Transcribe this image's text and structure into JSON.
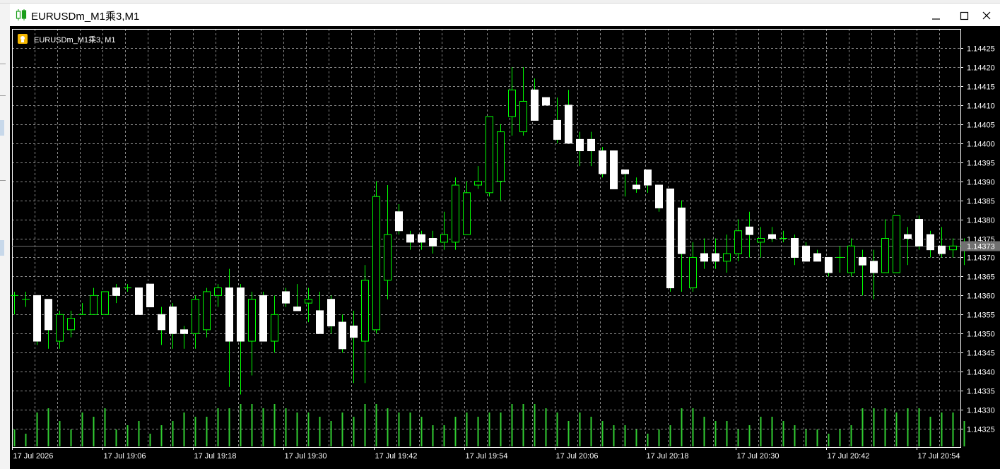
{
  "window": {
    "title": "EURUSDm_M1乘3,M1",
    "minimize_icon": "minimize-icon",
    "maximize_icon": "maximize-icon",
    "close_icon": "close-icon"
  },
  "chart_header": {
    "symbol_label": "EURUSDm_M1乘3, M1",
    "icon": "expert-advisor-icon"
  },
  "colors": {
    "background": "#000000",
    "grid": "#8a8a8a",
    "axis_text": "#ffffff",
    "bull_body": "#000000",
    "bear_body": "#ffffff",
    "candle_outline": "#00ff00",
    "volume": "#32cd32",
    "price_line": "#707070",
    "price_tag": "#707070"
  },
  "chart_data": {
    "type": "candlestick",
    "symbol": "EURUSDm_M1乘3",
    "timeframe": "M1",
    "y_ticks": [
      "1.14425",
      "1.14420",
      "1.14415",
      "1.14410",
      "1.14405",
      "1.14400",
      "1.14395",
      "1.14390",
      "1.14385",
      "1.14380",
      "1.14375",
      "1.14370",
      "1.14365",
      "1.14360",
      "1.14355",
      "1.14350",
      "1.14345",
      "1.14340",
      "1.14335",
      "1.14330",
      "1.14325"
    ],
    "ylim": [
      1.14322,
      1.14428
    ],
    "x_ticks": [
      "17 Jul 2026",
      "17 Jul 19:06",
      "17 Jul 19:18",
      "17 Jul 19:30",
      "17 Jul 19:42",
      "17 Jul 19:54",
      "17 Jul 20:06",
      "17 Jul 20:18",
      "17 Jul 20:30",
      "17 Jul 20:42",
      "17 Jul 20:54"
    ],
    "current_price": "1.14373",
    "grid": true,
    "candles": [
      {
        "o": 1.1436,
        "h": 1.14361,
        "l": 1.14355,
        "c": 1.1436
      },
      {
        "o": 1.14359,
        "h": 1.14361,
        "l": 1.14357,
        "c": 1.14359
      },
      {
        "o": 1.1436,
        "h": 1.1436,
        "l": 1.14347,
        "c": 1.14348
      },
      {
        "o": 1.14359,
        "h": 1.14359,
        "l": 1.14346,
        "c": 1.14351
      },
      {
        "o": 1.14348,
        "h": 1.14356,
        "l": 1.14346,
        "c": 1.14355
      },
      {
        "o": 1.14351,
        "h": 1.14356,
        "l": 1.14349,
        "c": 1.14354
      },
      {
        "o": 1.14355,
        "h": 1.14358,
        "l": 1.14355,
        "c": 1.14355
      },
      {
        "o": 1.14355,
        "h": 1.14362,
        "l": 1.14355,
        "c": 1.1436
      },
      {
        "o": 1.14355,
        "h": 1.14361,
        "l": 1.14355,
        "c": 1.14361
      },
      {
        "o": 1.14362,
        "h": 1.14363,
        "l": 1.14358,
        "c": 1.1436
      },
      {
        "o": 1.14362,
        "h": 1.14363,
        "l": 1.14361,
        "c": 1.14362
      },
      {
        "o": 1.14362,
        "h": 1.14362,
        "l": 1.14355,
        "c": 1.14355
      },
      {
        "o": 1.14363,
        "h": 1.14363,
        "l": 1.14358,
        "c": 1.14357
      },
      {
        "o": 1.14355,
        "h": 1.14357,
        "l": 1.14347,
        "c": 1.14351
      },
      {
        "o": 1.14357,
        "h": 1.14358,
        "l": 1.14346,
        "c": 1.1435
      },
      {
        "o": 1.14351,
        "h": 1.14352,
        "l": 1.14346,
        "c": 1.1435
      },
      {
        "o": 1.1435,
        "h": 1.1436,
        "l": 1.14346,
        "c": 1.14359
      },
      {
        "o": 1.14351,
        "h": 1.14362,
        "l": 1.14349,
        "c": 1.14361
      },
      {
        "o": 1.1436,
        "h": 1.14363,
        "l": 1.14357,
        "c": 1.14362
      },
      {
        "o": 1.14362,
        "h": 1.14367,
        "l": 1.14336,
        "c": 1.14348
      },
      {
        "o": 1.14362,
        "h": 1.14363,
        "l": 1.14334,
        "c": 1.14348
      },
      {
        "o": 1.14348,
        "h": 1.14361,
        "l": 1.14339,
        "c": 1.14359
      },
      {
        "o": 1.1436,
        "h": 1.14361,
        "l": 1.14348,
        "c": 1.14348
      },
      {
        "o": 1.14348,
        "h": 1.1436,
        "l": 1.14345,
        "c": 1.14355
      },
      {
        "o": 1.14361,
        "h": 1.14362,
        "l": 1.14357,
        "c": 1.14358
      },
      {
        "o": 1.14357,
        "h": 1.14363,
        "l": 1.14356,
        "c": 1.14356
      },
      {
        "o": 1.14358,
        "h": 1.14362,
        "l": 1.14353,
        "c": 1.14359
      },
      {
        "o": 1.14356,
        "h": 1.14361,
        "l": 1.1435,
        "c": 1.1435
      },
      {
        "o": 1.14359,
        "h": 1.1436,
        "l": 1.1435,
        "c": 1.14352
      },
      {
        "o": 1.14353,
        "h": 1.14355,
        "l": 1.14345,
        "c": 1.14346
      },
      {
        "o": 1.14352,
        "h": 1.14356,
        "l": 1.14337,
        "c": 1.14349
      },
      {
        "o": 1.14348,
        "h": 1.14368,
        "l": 1.14337,
        "c": 1.14364
      },
      {
        "o": 1.14351,
        "h": 1.1439,
        "l": 1.1435,
        "c": 1.14386
      },
      {
        "o": 1.14364,
        "h": 1.14389,
        "l": 1.14359,
        "c": 1.14376
      },
      {
        "o": 1.14382,
        "h": 1.14384,
        "l": 1.14376,
        "c": 1.14377
      },
      {
        "o": 1.14376,
        "h": 1.14377,
        "l": 1.14372,
        "c": 1.14374
      },
      {
        "o": 1.14376,
        "h": 1.14377,
        "l": 1.14372,
        "c": 1.14374
      },
      {
        "o": 1.14375,
        "h": 1.14377,
        "l": 1.14371,
        "c": 1.14373
      },
      {
        "o": 1.14374,
        "h": 1.14382,
        "l": 1.14372,
        "c": 1.14376
      },
      {
        "o": 1.14374,
        "h": 1.14391,
        "l": 1.14372,
        "c": 1.14389
      },
      {
        "o": 1.14376,
        "h": 1.1439,
        "l": 1.14376,
        "c": 1.14387
      },
      {
        "o": 1.14389,
        "h": 1.14394,
        "l": 1.14388,
        "c": 1.1439
      },
      {
        "o": 1.14387,
        "h": 1.14405,
        "l": 1.14386,
        "c": 1.14407
      },
      {
        "o": 1.1439,
        "h": 1.14405,
        "l": 1.14385,
        "c": 1.14403
      },
      {
        "o": 1.14407,
        "h": 1.1442,
        "l": 1.14402,
        "c": 1.14414
      },
      {
        "o": 1.14403,
        "h": 1.1442,
        "l": 1.14402,
        "c": 1.14411
      },
      {
        "o": 1.14414,
        "h": 1.14417,
        "l": 1.14406,
        "c": 1.14406
      },
      {
        "o": 1.14412,
        "h": 1.14412,
        "l": 1.1441,
        "c": 1.1441
      },
      {
        "o": 1.14406,
        "h": 1.14412,
        "l": 1.144,
        "c": 1.14401
      },
      {
        "o": 1.1441,
        "h": 1.14414,
        "l": 1.144,
        "c": 1.144
      },
      {
        "o": 1.14401,
        "h": 1.14403,
        "l": 1.14394,
        "c": 1.14398
      },
      {
        "o": 1.14401,
        "h": 1.14403,
        "l": 1.14394,
        "c": 1.14398
      },
      {
        "o": 1.14398,
        "h": 1.14399,
        "l": 1.14391,
        "c": 1.14392
      },
      {
        "o": 1.14398,
        "h": 1.14398,
        "l": 1.14388,
        "c": 1.14388
      },
      {
        "o": 1.14393,
        "h": 1.14393,
        "l": 1.14386,
        "c": 1.14392
      },
      {
        "o": 1.14389,
        "h": 1.14391,
        "l": 1.14387,
        "c": 1.14388
      },
      {
        "o": 1.14393,
        "h": 1.14393,
        "l": 1.14387,
        "c": 1.14389
      },
      {
        "o": 1.14389,
        "h": 1.14389,
        "l": 1.14382,
        "c": 1.14383
      },
      {
        "o": 1.14388,
        "h": 1.14388,
        "l": 1.14361,
        "c": 1.14362
      },
      {
        "o": 1.14383,
        "h": 1.14385,
        "l": 1.14361,
        "c": 1.14371
      },
      {
        "o": 1.14362,
        "h": 1.14374,
        "l": 1.14361,
        "c": 1.1437
      },
      {
        "o": 1.14371,
        "h": 1.14375,
        "l": 1.14367,
        "c": 1.14369
      },
      {
        "o": 1.14371,
        "h": 1.14375,
        "l": 1.14367,
        "c": 1.14369
      },
      {
        "o": 1.14369,
        "h": 1.14376,
        "l": 1.14366,
        "c": 1.14371
      },
      {
        "o": 1.14371,
        "h": 1.1438,
        "l": 1.14369,
        "c": 1.14377
      },
      {
        "o": 1.14378,
        "h": 1.14382,
        "l": 1.1437,
        "c": 1.14376
      },
      {
        "o": 1.14374,
        "h": 1.14378,
        "l": 1.1437,
        "c": 1.14375
      },
      {
        "o": 1.14376,
        "h": 1.14378,
        "l": 1.14374,
        "c": 1.14375
      },
      {
        "o": 1.14375,
        "h": 1.14377,
        "l": 1.14374,
        "c": 1.14375
      },
      {
        "o": 1.14375,
        "h": 1.14376,
        "l": 1.14368,
        "c": 1.1437
      },
      {
        "o": 1.14373,
        "h": 1.14374,
        "l": 1.14369,
        "c": 1.14369
      },
      {
        "o": 1.14371,
        "h": 1.14372,
        "l": 1.14369,
        "c": 1.14369
      },
      {
        "o": 1.1437,
        "h": 1.1437,
        "l": 1.14365,
        "c": 1.14366
      },
      {
        "o": 1.1437,
        "h": 1.14373,
        "l": 1.14366,
        "c": 1.1437
      },
      {
        "o": 1.14366,
        "h": 1.14375,
        "l": 1.14365,
        "c": 1.14373
      },
      {
        "o": 1.1437,
        "h": 1.14372,
        "l": 1.1436,
        "c": 1.14368
      },
      {
        "o": 1.14369,
        "h": 1.14372,
        "l": 1.14359,
        "c": 1.14366
      },
      {
        "o": 1.14366,
        "h": 1.1438,
        "l": 1.14366,
        "c": 1.14375
      },
      {
        "o": 1.14366,
        "h": 1.14381,
        "l": 1.14366,
        "c": 1.14381
      },
      {
        "o": 1.14376,
        "h": 1.14378,
        "l": 1.14368,
        "c": 1.14375
      },
      {
        "o": 1.1438,
        "h": 1.14381,
        "l": 1.14372,
        "c": 1.14373
      },
      {
        "o": 1.14376,
        "h": 1.14377,
        "l": 1.1437,
        "c": 1.14372
      },
      {
        "o": 1.14373,
        "h": 1.14378,
        "l": 1.1437,
        "c": 1.14371
      },
      {
        "o": 1.14372,
        "h": 1.14375,
        "l": 1.1437,
        "c": 1.14373
      },
      {
        "o": 1.14373,
        "h": 1.14375,
        "l": 1.14368,
        "c": 1.14373
      }
    ],
    "volumes": [
      4,
      3,
      8,
      9,
      6,
      4,
      8,
      7,
      9,
      4,
      5,
      6,
      3,
      5,
      6,
      8,
      7,
      7,
      9,
      9,
      10,
      10,
      9,
      10,
      9,
      8,
      8,
      7,
      6,
      8,
      7,
      10,
      10,
      9,
      8,
      8,
      7,
      5,
      5,
      7,
      8,
      7,
      8,
      8,
      10,
      10,
      10,
      9,
      8,
      6,
      8,
      7,
      6,
      5,
      5,
      4,
      3,
      4,
      5,
      9,
      9,
      7,
      6,
      6,
      4,
      5,
      7,
      7,
      6,
      5,
      4,
      4,
      3,
      4,
      5,
      9,
      9,
      9,
      8,
      9,
      9,
      7,
      8,
      8,
      6
    ]
  }
}
